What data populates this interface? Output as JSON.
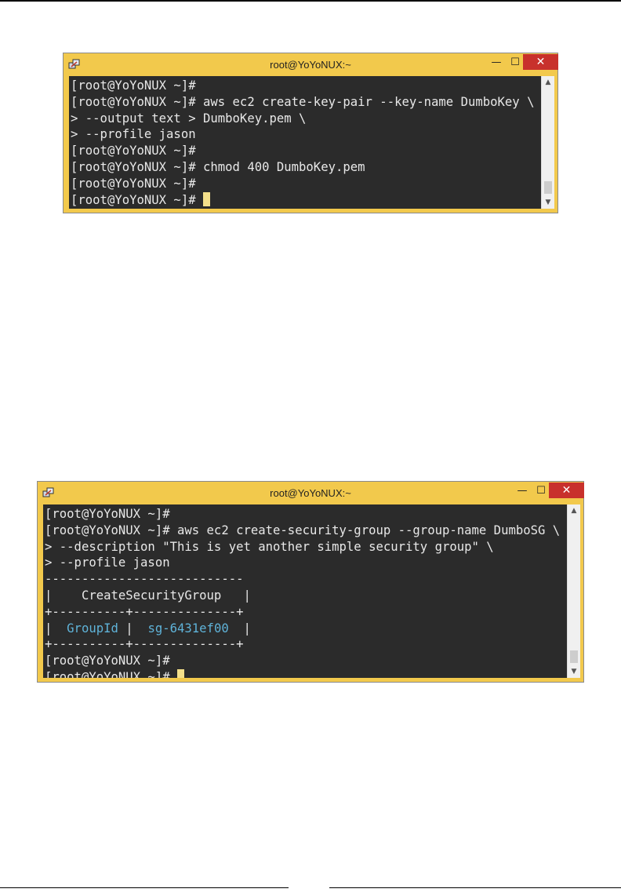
{
  "windows": [
    {
      "title": "root@YoYoNUX:~",
      "icon": "putty-icon",
      "controls": {
        "minimize": "—",
        "maximize": "☐",
        "close": "✕"
      },
      "lines": [
        "[root@YoYoNUX ~]#",
        "[root@YoYoNUX ~]# aws ec2 create-key-pair --key-name DumboKey \\",
        "> --output text > DumboKey.pem \\",
        "> --profile jason",
        "[root@YoYoNUX ~]#",
        "[root@YoYoNUX ~]# chmod 400 DumboKey.pem",
        "[root@YoYoNUX ~]#",
        "[root@YoYoNUX ~]# "
      ]
    },
    {
      "title": "root@YoYoNUX:~",
      "icon": "putty-icon",
      "controls": {
        "minimize": "—",
        "maximize": "☐",
        "close": "✕"
      },
      "lines": [
        "[root@YoYoNUX ~]#",
        "[root@YoYoNUX ~]# aws ec2 create-security-group --group-name DumboSG \\",
        "> --description \"This is yet another simple security group\" \\",
        "> --profile jason"
      ],
      "table": {
        "border_top": "---------------------------",
        "header": "|    CreateSecurityGroup   |",
        "separator": "+----------+--------------+",
        "row_left": "|  ",
        "key": "GroupId",
        "mid": " |  ",
        "value": "sg-6431ef00",
        "row_right": "  |",
        "border_bottom": "+----------+--------------+"
      },
      "after_lines": [
        "[root@YoYoNUX ~]#",
        "[root@YoYoNUX ~]# "
      ]
    }
  ],
  "colors": {
    "frame": "#f2c94c",
    "terminal_bg": "#2b2b2b",
    "text": "#e8e8e8",
    "highlight": "#5fb3d9",
    "cursor": "#f4e08a",
    "close_button": "#c8312c"
  }
}
